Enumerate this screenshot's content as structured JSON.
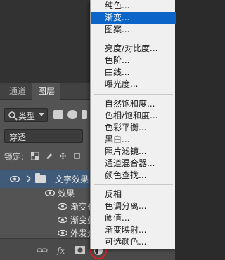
{
  "menu": {
    "items": [
      {
        "label": "纯色..."
      },
      {
        "label": "渐变...",
        "highlighted": true
      },
      {
        "label": "图案..."
      },
      {
        "label": "亮度/对比度..."
      },
      {
        "label": "色阶..."
      },
      {
        "label": "曲线..."
      },
      {
        "label": "曝光度..."
      },
      {
        "label": "自然饱和度..."
      },
      {
        "label": "色相/饱和度..."
      },
      {
        "label": "色彩平衡..."
      },
      {
        "label": "黑白..."
      },
      {
        "label": "照片滤镜..."
      },
      {
        "label": "通道混合器..."
      },
      {
        "label": "颜色查找..."
      },
      {
        "label": "反相"
      },
      {
        "label": "色调分离..."
      },
      {
        "label": "阈值..."
      },
      {
        "label": "渐变映射..."
      },
      {
        "label": "可选颜色..."
      }
    ]
  },
  "panel": {
    "tabs": [
      {
        "label": "通道"
      },
      {
        "label": "图层"
      }
    ],
    "filter_label": "类型",
    "blend_mode": "穿透",
    "lock_label": "锁定:",
    "layers": [
      {
        "name": "文字效果",
        "selected": true
      },
      {
        "name": "效果"
      },
      {
        "name": "渐变叠"
      },
      {
        "name": "渐变叠"
      },
      {
        "name": "外发光"
      }
    ]
  },
  "colors": {
    "menu_highlight": "#0b64c8",
    "panel_bg": "#535353",
    "selected_layer": "#3f5b79",
    "annotation_circle": "#e02020"
  }
}
